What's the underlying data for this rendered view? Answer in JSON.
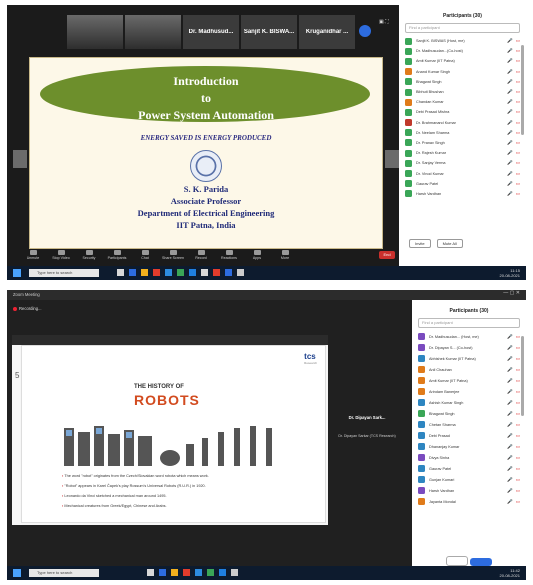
{
  "meeting1": {
    "thumbnails": [
      {
        "label": "",
        "video": true
      },
      {
        "label": "",
        "video": true
      },
      {
        "label": "Dr. Madhusud...",
        "video": false
      },
      {
        "label": "Sanjit K. BISWA...",
        "video": false
      },
      {
        "label": "Kruganidhar ...",
        "video": false
      }
    ],
    "slide": {
      "title_line1": "Introduction",
      "title_line2": "to",
      "title_line3": "Power System Automation",
      "subtitle": "ENERGY SAVED IS ENERGY PRODUCED",
      "name": "S. K. Parida",
      "designation": "Associate Professor",
      "department": "Department of Electrical Engineering",
      "institute": "IIT Patna, India"
    },
    "toolbar": [
      "Unmute",
      "Stop Video",
      "Security",
      "Participants",
      "Chat",
      "Share Screen",
      "Record",
      "Reactions",
      "Apps",
      "More"
    ],
    "end_label": "End",
    "panel": {
      "title": "Participants (30)",
      "search_placeholder": "Find a participant",
      "participants": [
        {
          "name": "Sanjit K. BISWAS (Host, me)",
          "color": "#3aa657"
        },
        {
          "name": "Dr. Madhusudan...(Co-host)",
          "color": "#3aa657"
        },
        {
          "name": "Amit Kumar (IIT Patna)",
          "color": "#3aa657"
        },
        {
          "name": "Anand Kumar Singh",
          "color": "#e07b1a"
        },
        {
          "name": "Bhagwat Singh",
          "color": "#3aa657"
        },
        {
          "name": "Bibhuti Bhushan",
          "color": "#3aa657"
        },
        {
          "name": "Chandan Kumar",
          "color": "#e07b1a"
        },
        {
          "name": "Debi Prasad Mishra",
          "color": "#3aa657"
        },
        {
          "name": "Dr. Brahmanand Kumar",
          "color": "#c0392b"
        },
        {
          "name": "Dr. Neelam Sharma",
          "color": "#3aa657"
        },
        {
          "name": "Dr. Pranav Singh",
          "color": "#3aa657"
        },
        {
          "name": "Dr. Rajesh Kumar",
          "color": "#3aa657"
        },
        {
          "name": "Dr. Sanjay Verma",
          "color": "#3aa657"
        },
        {
          "name": "Dr. Vinod Kumar",
          "color": "#3aa657"
        },
        {
          "name": "Gaurav Patel",
          "color": "#3aa657"
        },
        {
          "name": "Harsh Vardhan",
          "color": "#3aa657"
        }
      ],
      "invite_label": "Invite",
      "mute_label": "Mute All"
    },
    "taskbar": {
      "search_placeholder": "Type here to search",
      "time": "11:15",
      "date": "20-08-2021"
    }
  },
  "meeting2": {
    "title": "Zoom Meeting",
    "recording_label": "Recording...",
    "slide": {
      "page_number": "5",
      "brand": "tcs",
      "brand_sub": "Research",
      "heading_small": "THE HISTORY OF",
      "heading_big": "ROBOTS",
      "bullets": [
        "The word \"robot\" originates from the Czech/Slovakian word robota which means work.",
        "\"Robot\" appears in Karel Čapek's play Rossum's Universal Robots (R.U.R.) in 1920.",
        "Leonardo da Vinci sketched a mechanical man around 1495.",
        "Mechanical creatures from Greek/Egypt, Chinese and Arabs."
      ]
    },
    "speaker": {
      "name": "Dr. Dipayan Sark...",
      "sub": "Dr. Dipayan Sarkar (TCS Research)"
    },
    "panel": {
      "title": "Participants (30)",
      "search_placeholder": "Find a participant",
      "participants": [
        {
          "name": "Dr. Madhusudan... (Host, me)",
          "color": "#7a4bbf"
        },
        {
          "name": "Dr. Dipayan S... (Co-host)",
          "color": "#7a4bbf"
        },
        {
          "name": "Abhishek Kumar (IIT Patna)",
          "color": "#2e86c1"
        },
        {
          "name": "Anil Chauhan",
          "color": "#e07b1a"
        },
        {
          "name": "Amit Kumar (IIT Patna)",
          "color": "#e07b1a"
        },
        {
          "name": "Arindam Banerjee",
          "color": "#e07b1a"
        },
        {
          "name": "Ashish Kumar Singh",
          "color": "#2e86c1"
        },
        {
          "name": "Bhagwat Singh",
          "color": "#3aa657"
        },
        {
          "name": "Chetan Sharma",
          "color": "#2e86c1"
        },
        {
          "name": "Debi Prasad",
          "color": "#2e86c1"
        },
        {
          "name": "Dhananjay Kumar",
          "color": "#2e86c1"
        },
        {
          "name": "Divya Sinha",
          "color": "#7a4bbf"
        },
        {
          "name": "Gaurav Patel",
          "color": "#2e86c1"
        },
        {
          "name": "Gunjan Kumari",
          "color": "#2e86c1"
        },
        {
          "name": "Harsh Vardhan",
          "color": "#7a4bbf"
        },
        {
          "name": "Jayanta Mondal",
          "color": "#e07b1a"
        }
      ]
    },
    "taskbar": {
      "search_placeholder": "Type here to search",
      "time": "11:42",
      "date": "20-08-2021"
    }
  }
}
